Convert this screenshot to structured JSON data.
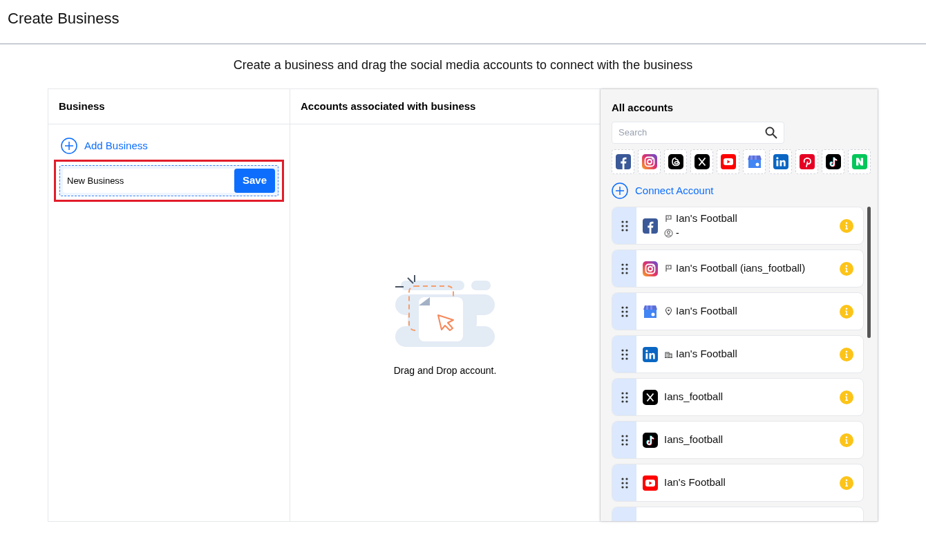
{
  "page": {
    "title": "Create Business",
    "subtitle": "Create a business and drag the social media accounts to connect with the business"
  },
  "business_column": {
    "heading": "Business",
    "add_label": "Add Business",
    "new_business": {
      "value": "New Business",
      "save_label": "Save",
      "highlighted": true
    }
  },
  "associated_column": {
    "heading": "Accounts associated with business",
    "empty_text": "Drag and Drop account."
  },
  "all_accounts": {
    "heading": "All accounts",
    "search": {
      "placeholder": "Search"
    },
    "platform_filters": [
      {
        "kind": "facebook"
      },
      {
        "kind": "instagram"
      },
      {
        "kind": "threads"
      },
      {
        "kind": "x"
      },
      {
        "kind": "youtube"
      },
      {
        "kind": "gbp"
      },
      {
        "kind": "linkedin"
      },
      {
        "kind": "pinterest"
      },
      {
        "kind": "tiktok"
      },
      {
        "kind": "naver"
      }
    ],
    "connect_label": "Connect Account",
    "accounts": [
      {
        "kind": "facebook",
        "badge": {
          "kind": "page"
        },
        "name": "Ian's Football",
        "detail": "-"
      },
      {
        "kind": "instagram",
        "badge": {
          "kind": "page"
        },
        "name": "Ian's Football (ians_football)"
      },
      {
        "kind": "gbp",
        "badge": {
          "kind": "location"
        },
        "name": "Ian's Football"
      },
      {
        "kind": "linkedin",
        "badge": {
          "kind": "organization"
        },
        "name": "Ian's Football"
      },
      {
        "kind": "x",
        "name": "Ians_football"
      },
      {
        "kind": "tiktok",
        "name": "Ians_football"
      },
      {
        "kind": "youtube",
        "name": "Ian's Football"
      }
    ]
  }
}
